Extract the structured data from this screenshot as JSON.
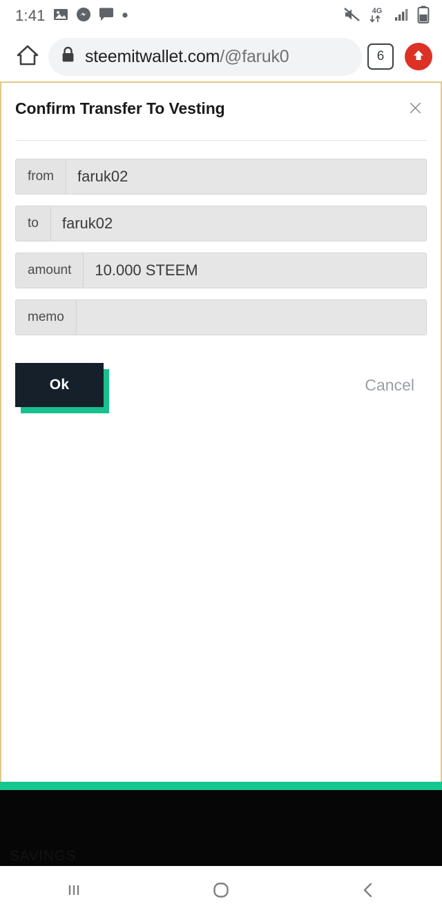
{
  "status_bar": {
    "time": "1:41",
    "left_icons": [
      {
        "name": "gallery-icon",
        "label": "image"
      },
      {
        "name": "messenger-icon",
        "label": "messenger"
      },
      {
        "name": "chat-bubble-icon",
        "label": "message"
      },
      {
        "name": "dot-indicator-icon",
        "label": "more"
      }
    ],
    "right_icons": [
      {
        "name": "volume-muted-icon",
        "label": "muted"
      },
      {
        "name": "mobile-data-4g-icon",
        "label": "4G"
      },
      {
        "name": "signal-bars-icon",
        "label": "signal"
      },
      {
        "name": "battery-icon",
        "label": "battery"
      }
    ],
    "network_label": "4G"
  },
  "browser": {
    "home_label": "Home",
    "url_host": "steemitwallet.com",
    "url_path": "/@faruk0",
    "secure": true,
    "tab_count": "6",
    "upload_label": "Upload"
  },
  "modal": {
    "title": "Confirm Transfer To Vesting",
    "close_label": "×",
    "fields": [
      {
        "label": "from",
        "value": "faruk02",
        "placeholder": ""
      },
      {
        "label": "to",
        "value": "faruk02",
        "placeholder": ""
      },
      {
        "label": "amount",
        "value": "10.000 STEEM",
        "placeholder": ""
      },
      {
        "label": "memo",
        "value": "",
        "placeholder": ""
      }
    ],
    "ok_label": "Ok",
    "cancel_label": "Cancel"
  },
  "background_page": {
    "obscured_line_1": "",
    "obscured_line_2": "",
    "savings_heading": "SAVINGS"
  },
  "nav_bar": {
    "recents_label": "Recents",
    "home_label": "Home",
    "back_label": "Back"
  },
  "colors": {
    "accent_green": "#15c78f",
    "button_dark": "#16202b",
    "upload_red": "#dc3125",
    "page_border": "#e2c98a",
    "field_bg": "#e6e6e6"
  }
}
